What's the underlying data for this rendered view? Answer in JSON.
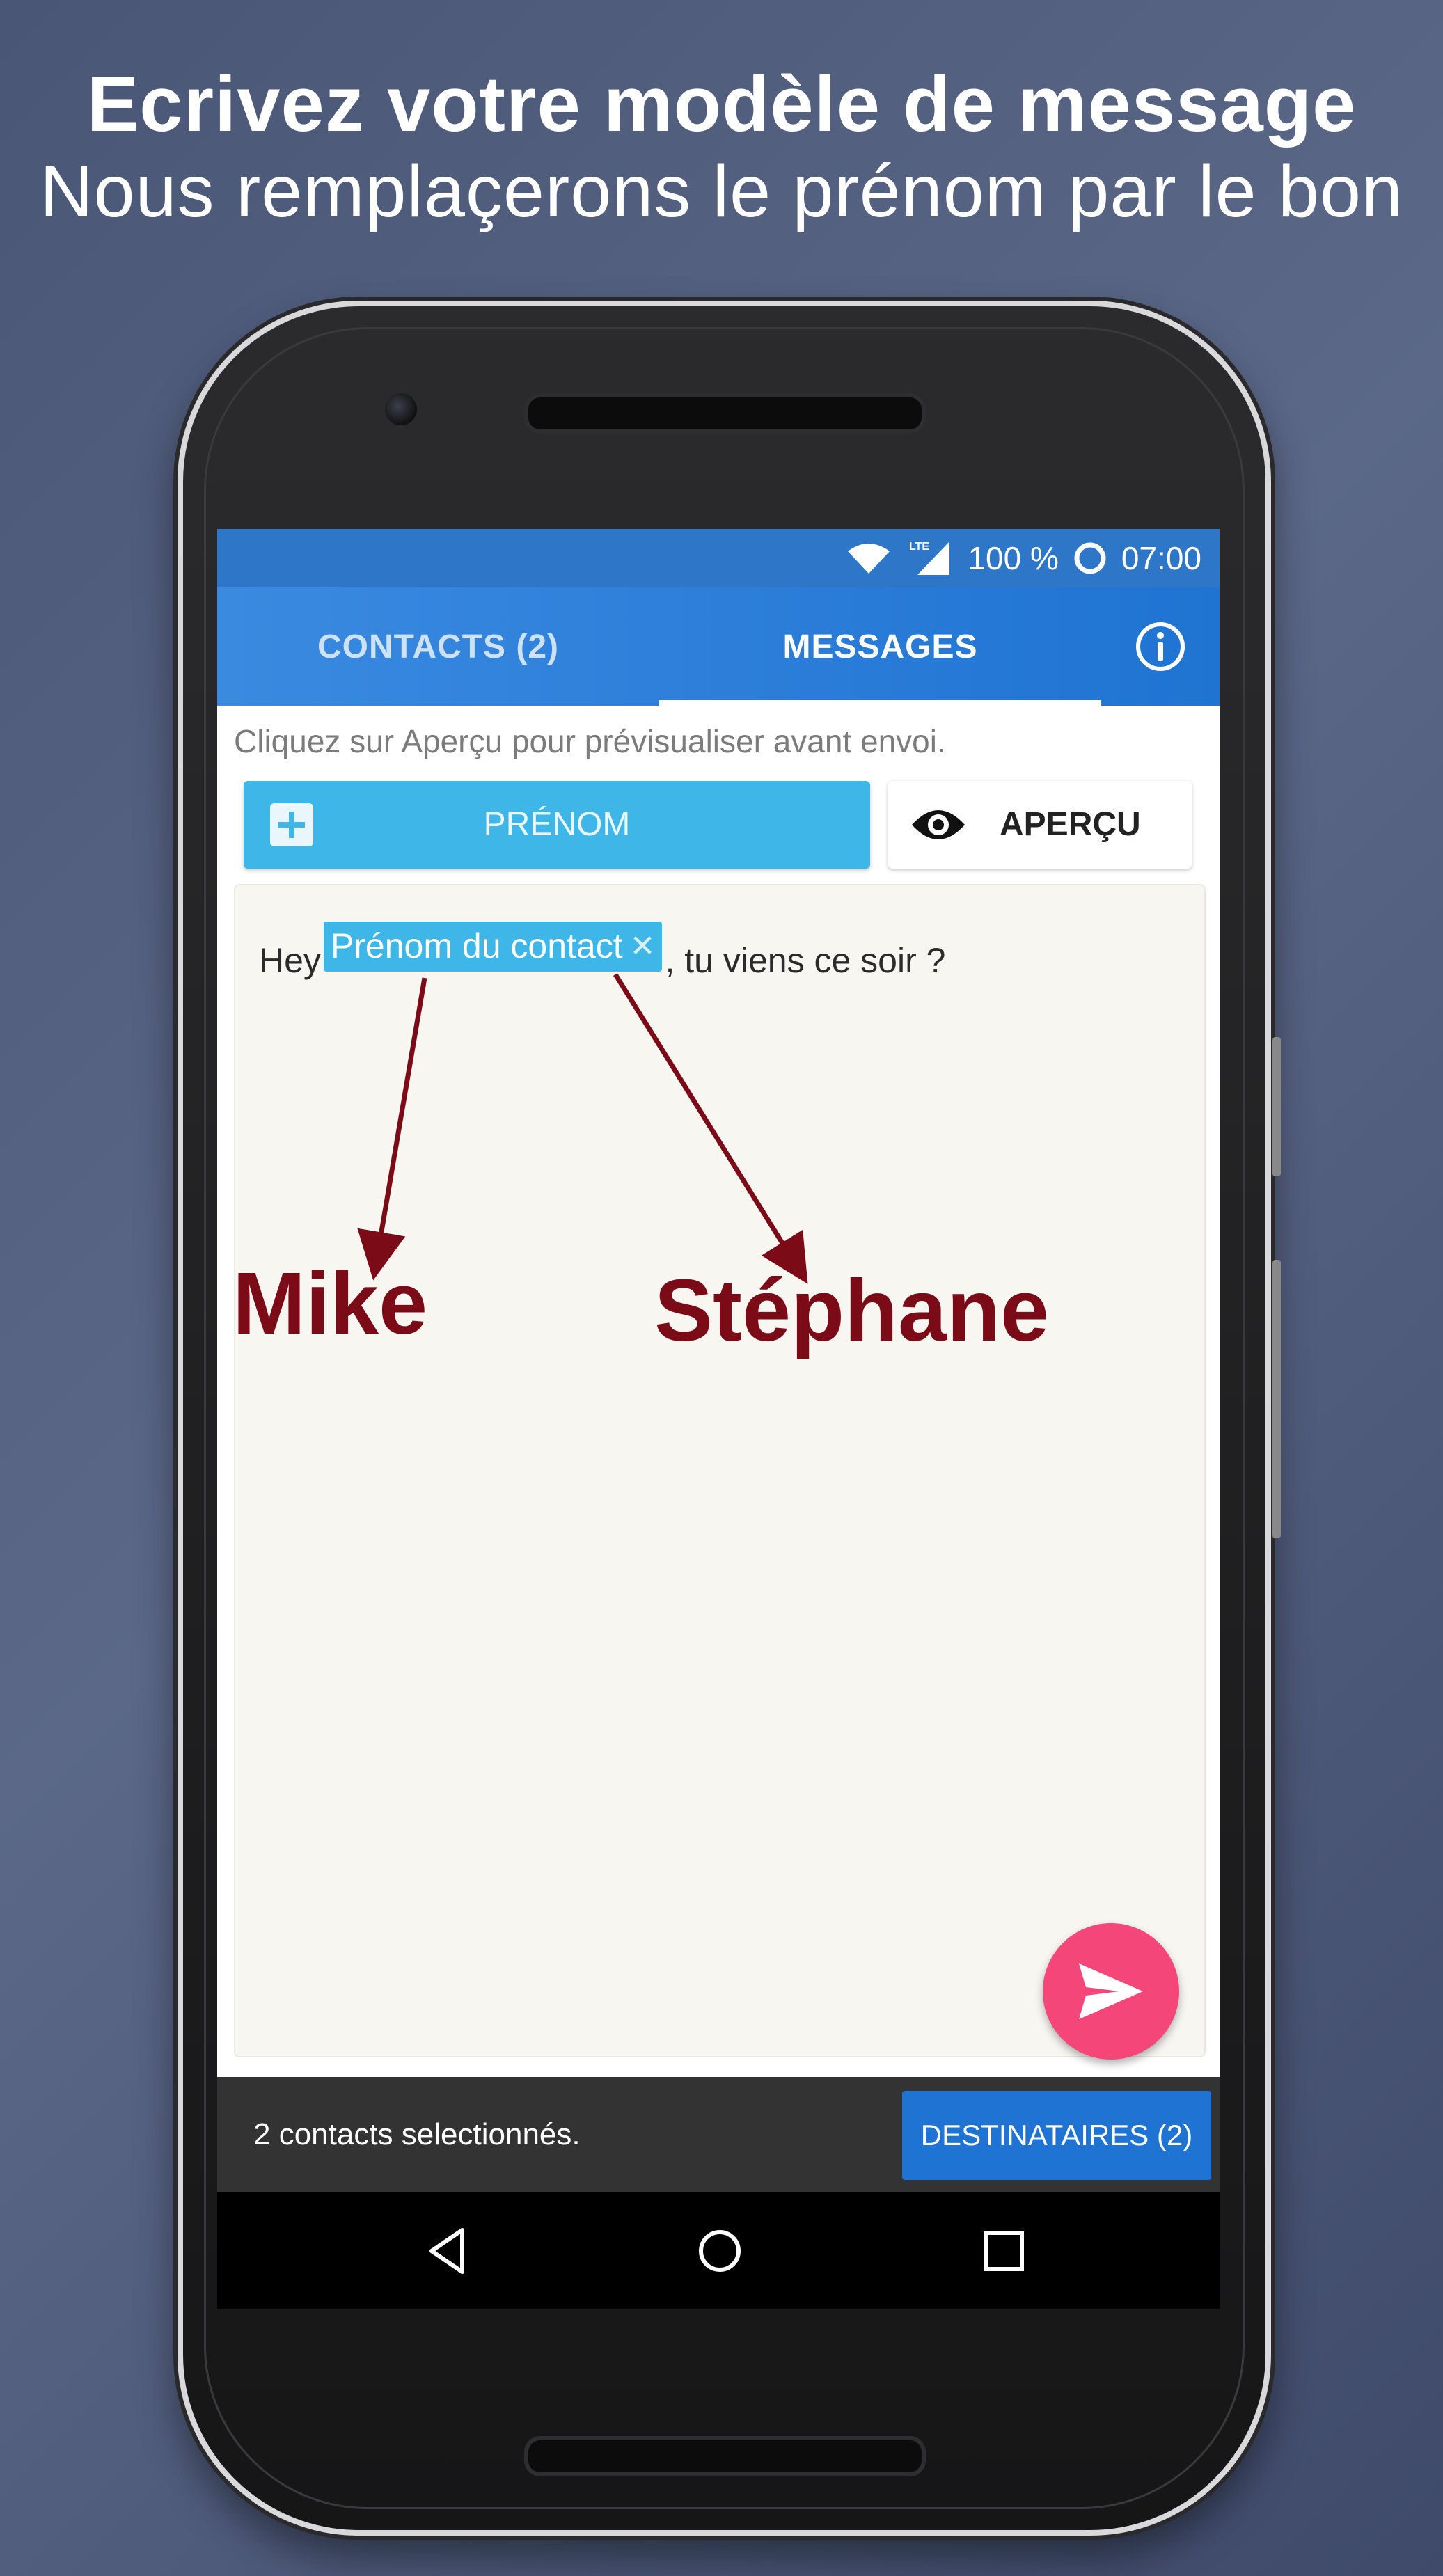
{
  "headline": {
    "line1": "Ecrivez votre modèle de message",
    "line2": "Nous remplaçerons le prénom par le bon"
  },
  "status_bar": {
    "network": "LTE",
    "battery": "100 %",
    "time": "07:00"
  },
  "tabs": [
    {
      "label": "CONTACTS (2)",
      "selected": false
    },
    {
      "label": "MESSAGES",
      "selected": true
    }
  ],
  "hint": "Cliquez sur Aperçu pour prévisualiser avant envoi.",
  "buttons": {
    "prenom": "PRÉNOM",
    "apercu": "APERÇU"
  },
  "message": {
    "prefix": "Hey",
    "chip": "Prénom du contact",
    "suffix": ", tu viens ce soir ?"
  },
  "annotations": {
    "name1": "Mike",
    "name2": "Stéphane"
  },
  "footer": {
    "selected": "2 contacts selectionnés.",
    "recipients_button": "DESTINATAIRES (2)"
  },
  "colors": {
    "tab_bar": "#1f73d2",
    "chip": "#3fb6e8",
    "fab": "#f5467a",
    "annotation": "#7b0b17"
  }
}
